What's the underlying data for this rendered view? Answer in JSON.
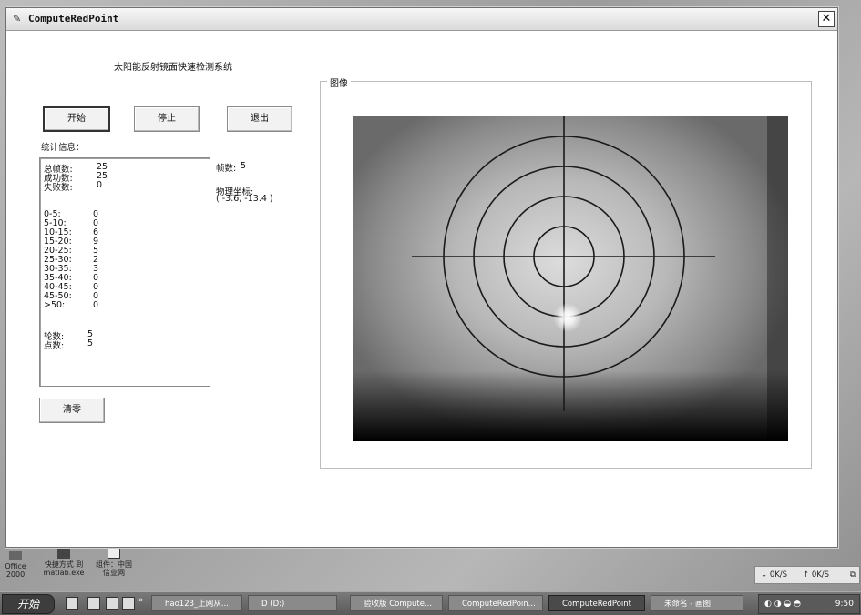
{
  "window": {
    "title": "ComputeRedPoint",
    "close_label": "✕"
  },
  "heading": "太阳能反射镜面快速检测系统",
  "buttons": {
    "start": "开始",
    "stop": "停止",
    "exit": "退出",
    "clear": "清零"
  },
  "stats": {
    "label": "统计信息：",
    "summary": [
      {
        "k": "总帧数:",
        "v": "25"
      },
      {
        "k": "成功数:",
        "v": "25"
      },
      {
        "k": "失败数:",
        "v": "0"
      }
    ],
    "bins": [
      {
        "k": "0-5:",
        "v": "0"
      },
      {
        "k": "5-10:",
        "v": "0"
      },
      {
        "k": "10-15:",
        "v": "6"
      },
      {
        "k": "15-20:",
        "v": "9"
      },
      {
        "k": "20-25:",
        "v": "5"
      },
      {
        "k": "25-30:",
        "v": "2"
      },
      {
        "k": "30-35:",
        "v": "3"
      },
      {
        "k": "35-40:",
        "v": "0"
      },
      {
        "k": "40-45:",
        "v": "0"
      },
      {
        "k": "45-50:",
        "v": "0"
      },
      {
        "k": ">50:",
        "v": "0"
      }
    ],
    "footer": [
      {
        "k": "轮数:",
        "v": "5"
      },
      {
        "k": "点数:",
        "v": "5"
      }
    ]
  },
  "frame_info": {
    "frame_label": "帧数:",
    "frame_value": "5",
    "coord_label": "物理坐标:",
    "coord_value": "( -3.6, -13.4 )"
  },
  "image_group": {
    "label": "图像"
  },
  "netmeter": {
    "down": "↓   0K/S",
    "up": "↑   0K/S"
  },
  "taskbar": {
    "start": "开始",
    "items": [
      {
        "label": "hao123_上网从...",
        "active": false
      },
      {
        "label": "D (D:)",
        "active": false
      },
      {
        "label": "验收版 Compute...",
        "active": false
      },
      {
        "label": "ComputeRedPoin...",
        "active": false
      },
      {
        "label": "ComputeRedPoint",
        "active": true
      },
      {
        "label": "未命名 - 画图",
        "active": false
      }
    ],
    "clock": "9:50"
  },
  "desktop_icons": [
    {
      "label": "Office 2000"
    },
    {
      "label": "快捷方式 到 matlab.exe"
    },
    {
      "label": "组件：中国 信业网"
    }
  ],
  "colors": {
    "window_bg": "#ffffff",
    "titlebar": "#e6e6e6",
    "taskbar": "#5a5a5a"
  }
}
